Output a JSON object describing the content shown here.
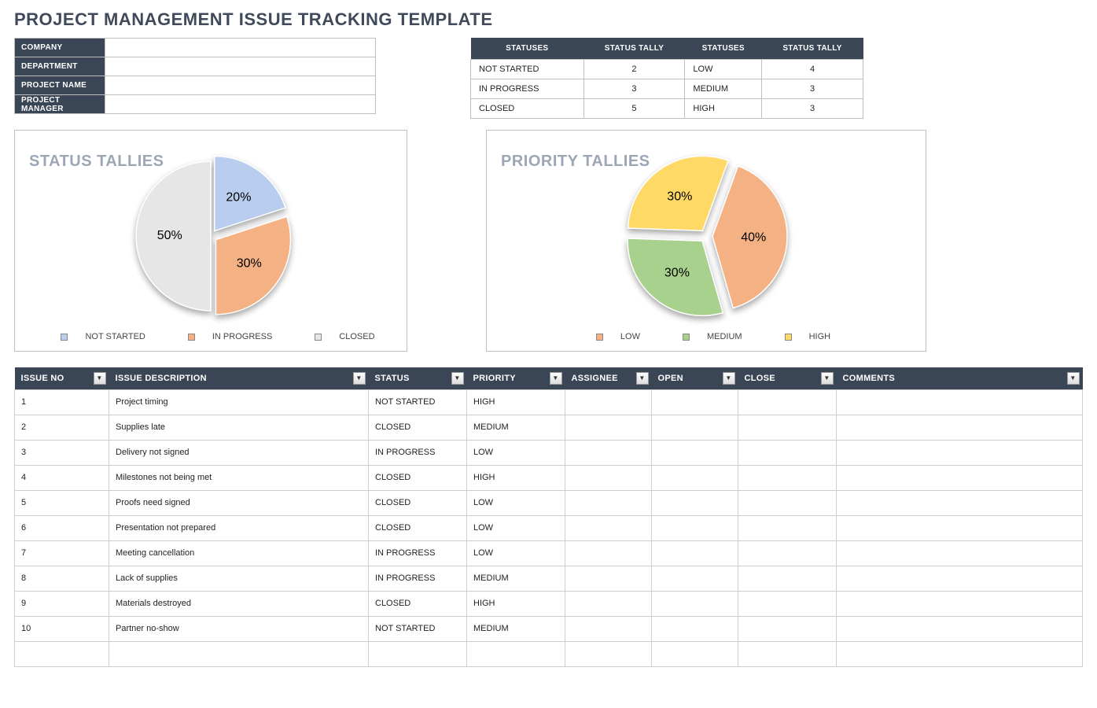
{
  "title": "PROJECT MANAGEMENT ISSUE TRACKING TEMPLATE",
  "info_labels": [
    "COMPANY",
    "DEPARTMENT",
    "PROJECT NAME",
    "PROJECT MANAGER"
  ],
  "info_values": [
    "",
    "",
    "",
    ""
  ],
  "tally_headers": [
    "STATUSES",
    "STATUS TALLY",
    "STATUSES",
    "STATUS TALLY"
  ],
  "tally_rows": [
    {
      "s1": "NOT STARTED",
      "t1": "2",
      "s2": "LOW",
      "t2": "4"
    },
    {
      "s1": "IN PROGRESS",
      "t1": "3",
      "s2": "MEDIUM",
      "t2": "3"
    },
    {
      "s1": "CLOSED",
      "t1": "5",
      "s2": "HIGH",
      "t2": "3"
    }
  ],
  "chart_data": [
    {
      "type": "pie",
      "title": "STATUS TALLIES",
      "categories": [
        "NOT STARTED",
        "IN PROGRESS",
        "CLOSED"
      ],
      "values": [
        20,
        30,
        50
      ],
      "labels": [
        "20%",
        "30%",
        "50%"
      ],
      "colors": [
        "#b9cdef",
        "#f4b183",
        "#e7e6e6"
      ],
      "exploded": [
        true,
        true,
        false
      ]
    },
    {
      "type": "pie",
      "title": "PRIORITY TALLIES",
      "categories": [
        "LOW",
        "MEDIUM",
        "HIGH"
      ],
      "values": [
        40,
        30,
        30
      ],
      "labels": [
        "40%",
        "30%",
        "30%"
      ],
      "colors": [
        "#f4b183",
        "#a9d18e",
        "#ffd966"
      ],
      "exploded": [
        true,
        true,
        true
      ]
    }
  ],
  "issue_headers": [
    "ISSUE NO",
    "ISSUE DESCRIPTION",
    "STATUS",
    "PRIORITY",
    "ASSIGNEE",
    "OPEN",
    "CLOSE",
    "COMMENTS"
  ],
  "issues": [
    {
      "no": "1",
      "desc": "Project timing",
      "status": "NOT STARTED",
      "priority": "HIGH",
      "assignee": "",
      "open": "",
      "close": "",
      "comments": ""
    },
    {
      "no": "2",
      "desc": "Supplies late",
      "status": "CLOSED",
      "priority": "MEDIUM",
      "assignee": "",
      "open": "",
      "close": "",
      "comments": ""
    },
    {
      "no": "3",
      "desc": "Delivery not signed",
      "status": "IN PROGRESS",
      "priority": "LOW",
      "assignee": "",
      "open": "",
      "close": "",
      "comments": ""
    },
    {
      "no": "4",
      "desc": "Milestones not being met",
      "status": "CLOSED",
      "priority": "HIGH",
      "assignee": "",
      "open": "",
      "close": "",
      "comments": ""
    },
    {
      "no": "5",
      "desc": "Proofs need signed",
      "status": "CLOSED",
      "priority": "LOW",
      "assignee": "",
      "open": "",
      "close": "",
      "comments": ""
    },
    {
      "no": "6",
      "desc": "Presentation not prepared",
      "status": "CLOSED",
      "priority": "LOW",
      "assignee": "",
      "open": "",
      "close": "",
      "comments": ""
    },
    {
      "no": "7",
      "desc": "Meeting cancellation",
      "status": "IN PROGRESS",
      "priority": "LOW",
      "assignee": "",
      "open": "",
      "close": "",
      "comments": ""
    },
    {
      "no": "8",
      "desc": "Lack of supplies",
      "status": "IN PROGRESS",
      "priority": "MEDIUM",
      "assignee": "",
      "open": "",
      "close": "",
      "comments": ""
    },
    {
      "no": "9",
      "desc": "Materials destroyed",
      "status": "CLOSED",
      "priority": "HIGH",
      "assignee": "",
      "open": "",
      "close": "",
      "comments": ""
    },
    {
      "no": "10",
      "desc": "Partner no-show",
      "status": "NOT STARTED",
      "priority": "MEDIUM",
      "assignee": "",
      "open": "",
      "close": "",
      "comments": ""
    },
    {
      "no": "",
      "desc": "",
      "status": "",
      "priority": "",
      "assignee": "",
      "open": "",
      "close": "",
      "comments": ""
    }
  ]
}
